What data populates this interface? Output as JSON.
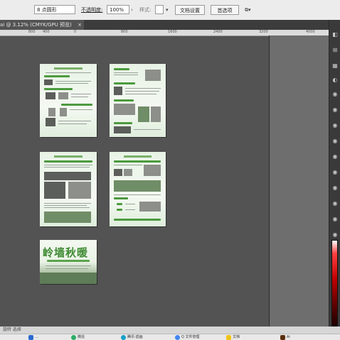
{
  "control_bar": {
    "stroke_value": "8 点圆形",
    "opacity_label": "不透明度:",
    "opacity_value": "100%",
    "style_label": "样式:",
    "doc_setup_label": "文档设置",
    "prefs_label": "首选项"
  },
  "tab": {
    "title": "ai @ 3.12% (CMYK/GPU 预览)",
    "close": "×"
  },
  "ruler": {
    "ticks": [
      "800",
      "400",
      "0",
      "800",
      "1600",
      "2400",
      "3200",
      "4000"
    ]
  },
  "status": {
    "text": "旋转 选择"
  },
  "poster": {
    "title": "岭墙秋暖"
  },
  "taskbar": {
    "items": [
      {
        "label": "…",
        "color": "#2a6bd1"
      },
      {
        "label": "微信",
        "color": "#2aae67"
      },
      {
        "label": "腾讯·插画",
        "color": "#1aa0c8"
      },
      {
        "label": "Q 文件管理",
        "color": "#4285f4"
      },
      {
        "label": "文档",
        "color": "#f0c419"
      },
      {
        "label": "Ai",
        "color": "#5a2d0c"
      }
    ]
  },
  "colors": {
    "canvas": "#535353",
    "accent_green": "#4c9a3e",
    "panel": "#3a3a3a"
  }
}
